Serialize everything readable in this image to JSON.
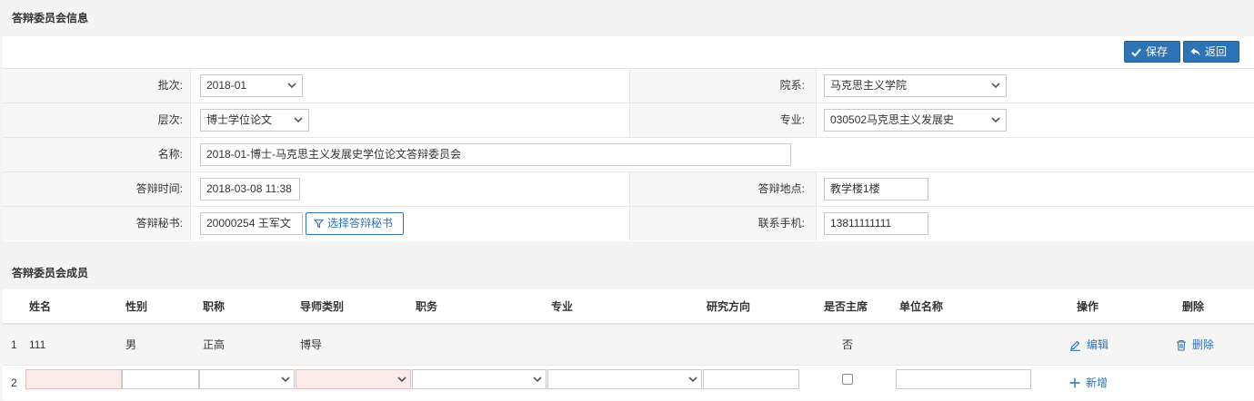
{
  "sections": {
    "info_title": "答辩委员会信息",
    "members_title": "答辩委员会成员"
  },
  "toolbar": {
    "save_label": "保存",
    "back_label": "返回"
  },
  "form": {
    "batch_label": "批次:",
    "batch_value": "2018-01",
    "department_label": "院系:",
    "department_value": "马克思主义学院",
    "level_label": "层次:",
    "level_value": "博士学位论文",
    "major_label": "专业:",
    "major_value": "030502马克思主义发展史",
    "name_label": "名称:",
    "name_value": "2018-01-博士-马克思主义发展史学位论文答辩委员会",
    "time_label": "答辩时间:",
    "time_value": "2018-03-08 11:38",
    "place_label": "答辩地点:",
    "place_value": "教学楼1楼",
    "secretary_label": "答辩秘书:",
    "secretary_value": "20000254 王军文",
    "select_secretary_label": "选择答辩秘书",
    "phone_label": "联系手机:",
    "phone_value": "13811111111"
  },
  "members": {
    "columns": [
      "姓名",
      "性别",
      "职称",
      "导师类别",
      "职务",
      "专业",
      "研究方向",
      "是否主席",
      "单位名称",
      "操作",
      "删除"
    ],
    "rows": [
      {
        "index": "1",
        "name": "111",
        "gender": "男",
        "title": "正高",
        "mentor_type": "博导",
        "is_chair": "否",
        "edit_label": "编辑",
        "delete_label": "删除"
      }
    ],
    "new_row": {
      "index": "2",
      "add_label": "新增"
    }
  },
  "colors": {
    "primary": "#2f73b7",
    "required_bg": "#fdeaea"
  },
  "icons": [
    "check-icon",
    "back-arrow-icon",
    "chevron-down-icon",
    "filter-icon",
    "pencil-icon",
    "trash-icon",
    "plus-icon"
  ]
}
